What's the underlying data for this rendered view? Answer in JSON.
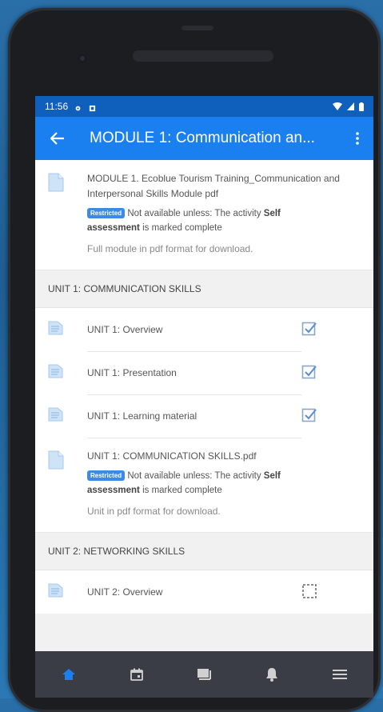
{
  "status": {
    "time": "11:56"
  },
  "appbar": {
    "title": "MODULE 1: Communication an..."
  },
  "module_file": {
    "name": "MODULE 1. Ecoblue Tourism Training_Communication and Interpersonal Skills Module pdf",
    "badge": "Restricted",
    "restriction_prefix": "Not available unless: The activity",
    "restriction_activity_a": "Self",
    "restriction_activity_b": "assessment",
    "restriction_suffix": "is marked complete",
    "description": "Full module in pdf format for download."
  },
  "unit1": {
    "header": "UNIT 1: COMMUNICATION SKILLS",
    "items": [
      {
        "label": "UNIT 1: Overview",
        "checked": true
      },
      {
        "label": "UNIT 1: Presentation",
        "checked": true
      },
      {
        "label": "UNIT 1: Learning material",
        "checked": true
      }
    ],
    "file": {
      "name": "UNIT 1: COMMUNICATION SKILLS.pdf",
      "badge": "Restricted",
      "restriction_prefix": "Not available unless: The activity",
      "restriction_activity_a": "Self",
      "restriction_activity_b": "assessment",
      "restriction_suffix": "is marked complete",
      "description": "Unit in pdf format for download."
    }
  },
  "unit2": {
    "header": "UNIT 2: NETWORKING SKILLS",
    "items": [
      {
        "label": "UNIT 2: Overview",
        "checked": false
      }
    ]
  },
  "nav": [
    "home-icon",
    "calendar-icon",
    "courses-icon",
    "notifications-icon",
    "menu-icon"
  ],
  "colors": {
    "statusbar": "#0f5fbd",
    "appbar": "#1a80f0",
    "accent": "#3b8be6",
    "navbar": "#3a3d45"
  }
}
